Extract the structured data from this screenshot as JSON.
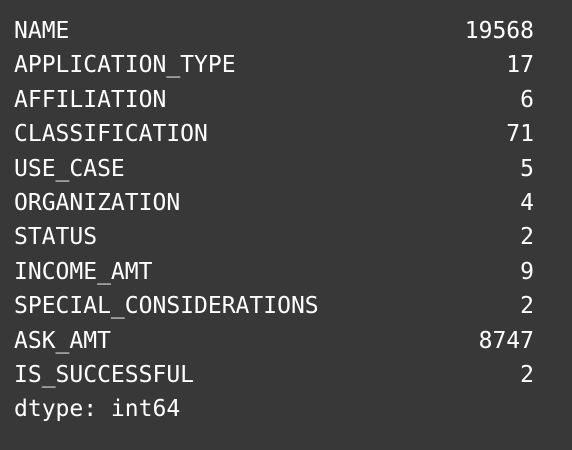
{
  "output": {
    "rows": [
      {
        "key": "NAME",
        "value": "19568"
      },
      {
        "key": "APPLICATION_TYPE",
        "value": "17"
      },
      {
        "key": "AFFILIATION",
        "value": "6"
      },
      {
        "key": "CLASSIFICATION",
        "value": "71"
      },
      {
        "key": "USE_CASE",
        "value": "5"
      },
      {
        "key": "ORGANIZATION",
        "value": "4"
      },
      {
        "key": "STATUS",
        "value": "2"
      },
      {
        "key": "INCOME_AMT",
        "value": "9"
      },
      {
        "key": "SPECIAL_CONSIDERATIONS",
        "value": "2"
      },
      {
        "key": "ASK_AMT",
        "value": "8747"
      },
      {
        "key": "IS_SUCCESSFUL",
        "value": "2"
      }
    ],
    "dtype": "dtype: int64"
  },
  "colors": {
    "background": "#383838",
    "text": "#ffffff"
  }
}
